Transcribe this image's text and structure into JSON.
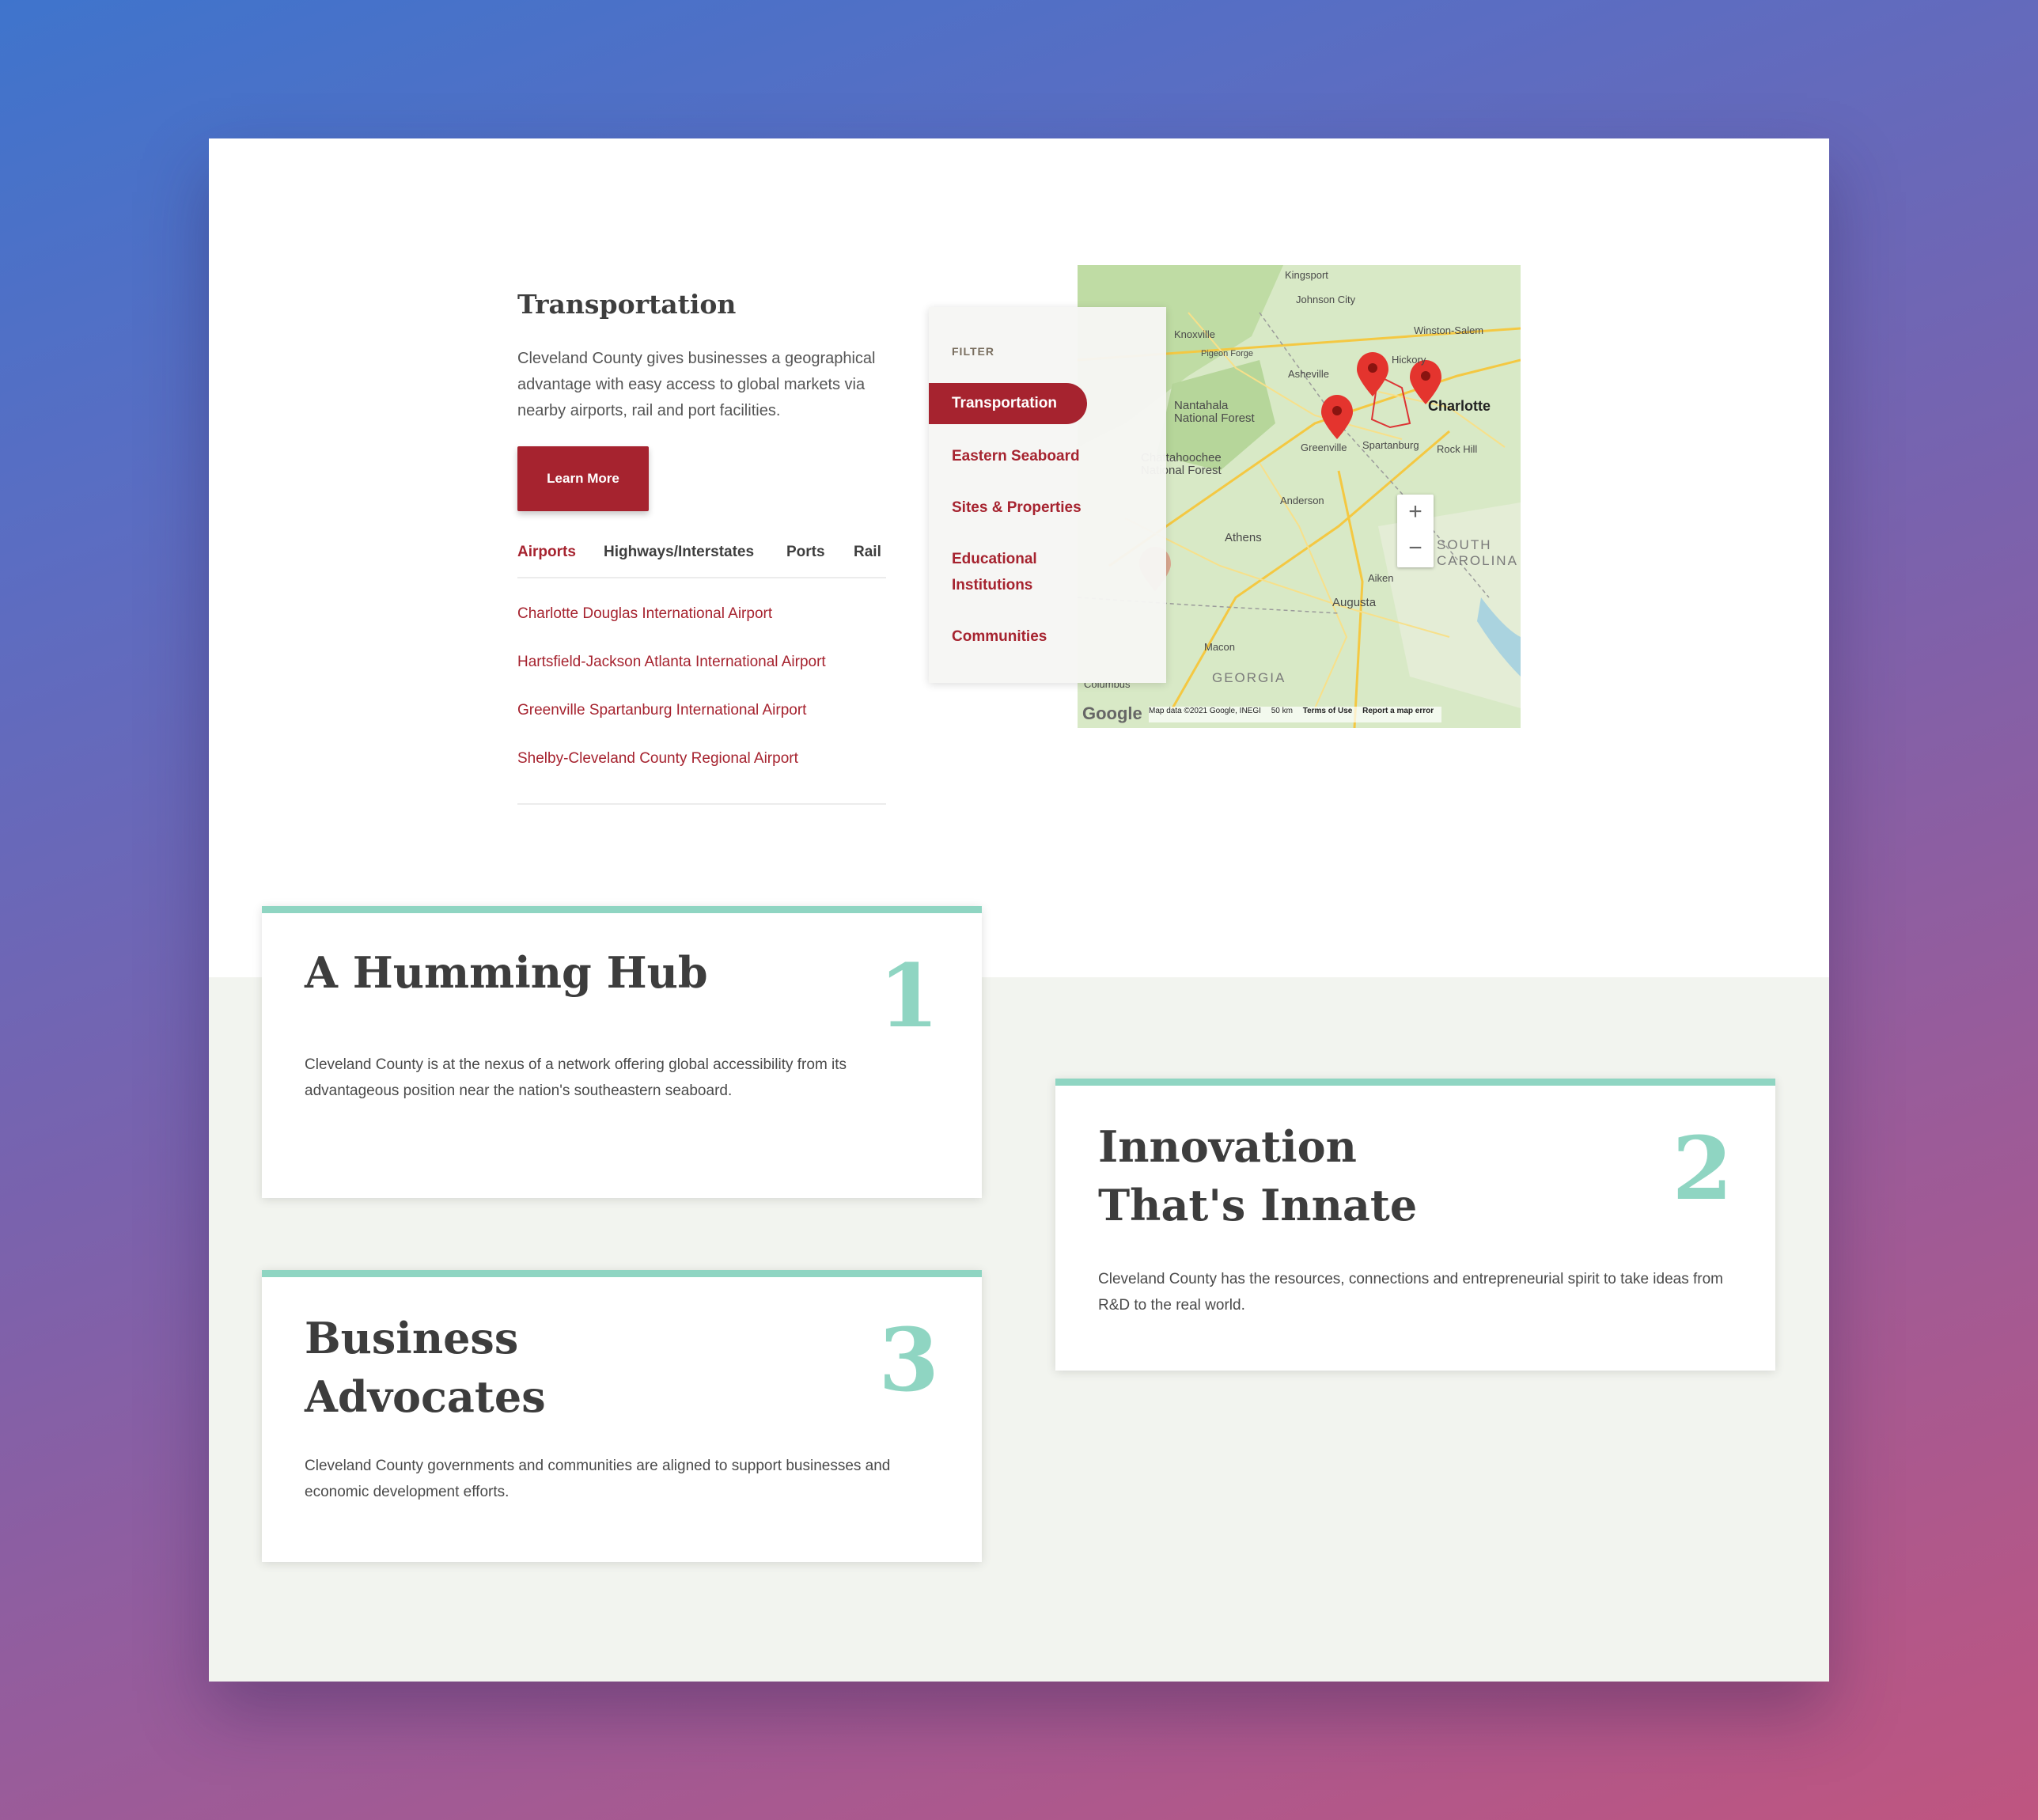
{
  "transportation": {
    "title": "Transportation",
    "description": "Cleveland County gives businesses a geographical advantage with easy access to global markets via nearby airports, rail and port facilities.",
    "cta_label": "Learn More",
    "tabs": [
      "Airports",
      "Highways/Interstates",
      "Ports",
      "Rail"
    ],
    "active_tab": "Airports",
    "airports": [
      "Charlotte Douglas International Airport",
      "Hartsfield-Jackson Atlanta International Airport",
      "Greenville Spartanburg International Airport",
      "Shelby-Cleveland County Regional Airport"
    ]
  },
  "filter": {
    "label": "FILTER",
    "items": [
      "Transportation",
      "Eastern Seaboard",
      "Sites & Properties",
      "Educational Institutions",
      "Communities"
    ],
    "active": "Transportation"
  },
  "map": {
    "labels": [
      "Kingsport",
      "Johnson City",
      "Knoxville",
      "Winston-Salem",
      "Pigeon Forge",
      "Hickory",
      "Asheville",
      "Nantahala National Forest",
      "Charlotte",
      "Greenville",
      "Spartanburg",
      "Rock Hill",
      "Chattahoochee National Forest",
      "Anderson",
      "Athens",
      "SOUTH CAROLINA",
      "Aiken",
      "Augusta",
      "Macon",
      "GEORGIA",
      "Columbus"
    ],
    "attribution": {
      "logo": "Google",
      "data": "Map data ©2021 Google, INEGI",
      "scale": "50 km",
      "terms": "Terms of Use",
      "report": "Report a map error"
    },
    "zoom_in": "+",
    "zoom_out": "−"
  },
  "cards": [
    {
      "number": "1",
      "title": "A Humming Hub",
      "description": "Cleveland County is at the nexus of a network offering global accessibility from its advantageous position near the nation's southeastern seaboard."
    },
    {
      "number": "2",
      "title_line1": "Innovation",
      "title_line2": "That's Innate",
      "description": "Cleveland County has the resources, connections and entrepreneurial spirit to take ideas from R&D to the real world."
    },
    {
      "number": "3",
      "title_line1": "Business",
      "title_line2": "Advocates",
      "description": "Cleveland County governments and communities are aligned to support businesses and economic development efforts."
    }
  ],
  "colors": {
    "brand_red": "#a6232f",
    "accent_mint": "#8fd5c2",
    "band_gray": "#f2f4ef"
  }
}
